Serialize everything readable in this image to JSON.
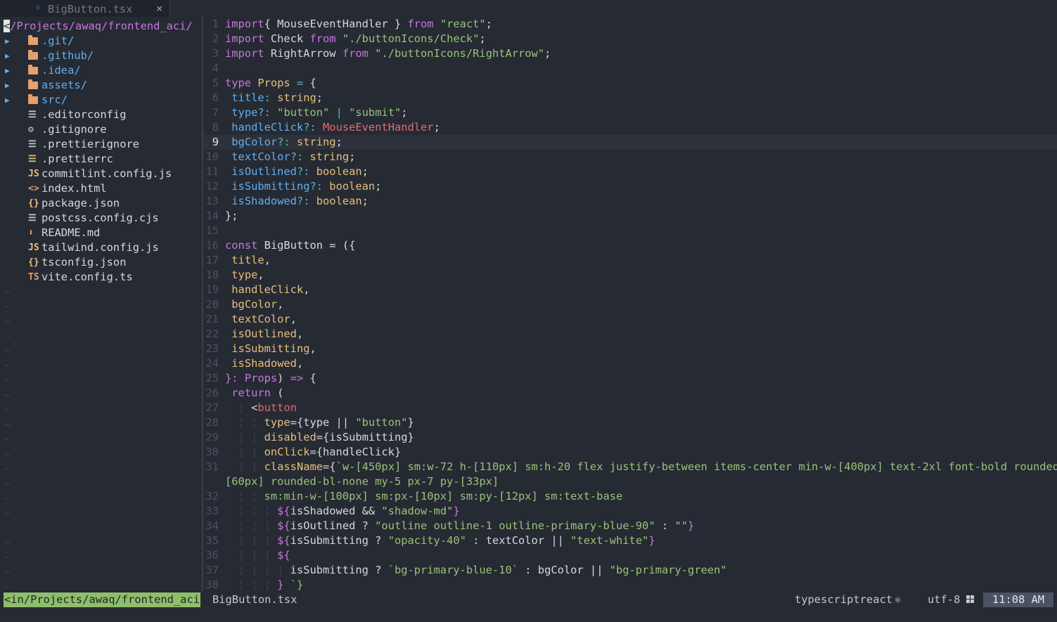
{
  "tab": {
    "icon": "react-icon",
    "title": "BigButton.tsx",
    "close": "×"
  },
  "tree": {
    "root": "/Projects/awaq/frontend_aci/",
    "root_cursor": "<",
    "items": [
      {
        "name": ".git/",
        "type": "dir",
        "icon": "folder-icon"
      },
      {
        "name": ".github/",
        "type": "dir",
        "icon": "folder-icon"
      },
      {
        "name": ".idea/",
        "type": "dir",
        "icon": "folder-icon"
      },
      {
        "name": "assets/",
        "type": "dir",
        "icon": "folder-icon"
      },
      {
        "name": "src/",
        "type": "dir",
        "icon": "folder-icon"
      },
      {
        "name": ".editorconfig",
        "type": "file",
        "icon": "lines-icon",
        "glyph": "☰",
        "color": "#c3c7cf"
      },
      {
        "name": ".gitignore",
        "type": "file",
        "icon": "gear-icon",
        "glyph": "⚙",
        "color": "#c3c7cf"
      },
      {
        "name": ".prettierignore",
        "type": "file",
        "icon": "lines-icon",
        "glyph": "☰",
        "color": "#c3c7cf"
      },
      {
        "name": ".prettierrc",
        "type": "file",
        "icon": "lines-icon",
        "glyph": "☰",
        "color": "#e5c07b"
      },
      {
        "name": "commitlint.config.js",
        "type": "file",
        "icon": "js-icon",
        "glyph": "JS",
        "color": "#e5c07b"
      },
      {
        "name": "index.html",
        "type": "file",
        "icon": "html-icon",
        "glyph": "<>",
        "color": "#e5a06b"
      },
      {
        "name": "package.json",
        "type": "file",
        "icon": "json-icon",
        "glyph": "{}",
        "color": "#e5c07b"
      },
      {
        "name": "postcss.config.cjs",
        "type": "file",
        "icon": "lines-icon",
        "glyph": "☰",
        "color": "#c3c7cf"
      },
      {
        "name": "README.md",
        "type": "file",
        "icon": "download-icon",
        "glyph": "⬇",
        "color": "#e5a06b"
      },
      {
        "name": "tailwind.config.js",
        "type": "file",
        "icon": "js-icon",
        "glyph": "JS",
        "color": "#e5c07b"
      },
      {
        "name": "tsconfig.json",
        "type": "file",
        "icon": "json-icon",
        "glyph": "{}",
        "color": "#e5c07b"
      },
      {
        "name": "vite.config.ts",
        "type": "file",
        "icon": "ts-icon",
        "glyph": "TS",
        "color": "#e5a06b"
      }
    ],
    "empty_marker": "~"
  },
  "editor": {
    "current_line": 9,
    "lines": [
      {
        "n": "1",
        "t": [
          [
            "k",
            "import"
          ],
          [
            "",
            "{ MouseEventHandler } "
          ],
          [
            "k",
            "from"
          ],
          [
            "s",
            " \"react\""
          ],
          [
            "",
            ";"
          ]
        ]
      },
      {
        "n": "2",
        "t": [
          [
            "k",
            "import"
          ],
          [
            "",
            ""
          ],
          [
            "",
            "Check "
          ],
          [
            "k",
            "from"
          ],
          [
            "s",
            " \"./buttonIcons/Check\""
          ],
          [
            "",
            ";"
          ]
        ]
      },
      {
        "n": "3",
        "t": [
          [
            "k",
            "import"
          ],
          [
            "",
            ""
          ],
          [
            "",
            "RightArrow "
          ],
          [
            "k",
            "from"
          ],
          [
            "s",
            " \"./buttonIcons/RightArrow\""
          ],
          [
            "",
            ";"
          ]
        ]
      },
      {
        "n": "4",
        "t": []
      },
      {
        "n": "5",
        "t": [
          [
            "k",
            "type"
          ],
          [
            "t",
            " Props"
          ],
          [
            "o",
            " ="
          ],
          [
            "",
            ""
          ],
          [
            "",
            "{"
          ]
        ]
      },
      {
        "n": "6",
        "t": [
          [
            "",
            ""
          ],
          [
            "p",
            "title"
          ],
          [
            "o",
            ":"
          ],
          [
            "t",
            " string"
          ],
          [
            "",
            ";"
          ]
        ]
      },
      {
        "n": "7",
        "t": [
          [
            "",
            ""
          ],
          [
            "p",
            "type"
          ],
          [
            "o",
            "?:"
          ],
          [
            "s",
            " \"button\""
          ],
          [
            "o",
            " |"
          ],
          [
            "s",
            " \"submit\""
          ],
          [
            "",
            ";"
          ]
        ]
      },
      {
        "n": "8",
        "t": [
          [
            "",
            ""
          ],
          [
            "p",
            "handleClick"
          ],
          [
            "o",
            "?:"
          ],
          [
            "r",
            " MouseEventHandler"
          ],
          [
            "",
            ";"
          ]
        ]
      },
      {
        "n": "9",
        "t": [
          [
            "",
            ""
          ],
          [
            "p",
            "bgColor"
          ],
          [
            "o",
            "?:"
          ],
          [
            "t",
            " string"
          ],
          [
            "",
            ";"
          ]
        ]
      },
      {
        "n": "10",
        "t": [
          [
            "",
            ""
          ],
          [
            "p",
            "textColor"
          ],
          [
            "o",
            "?:"
          ],
          [
            "t",
            " string"
          ],
          [
            "",
            ";"
          ]
        ]
      },
      {
        "n": "11",
        "t": [
          [
            "",
            ""
          ],
          [
            "p",
            "isOutlined"
          ],
          [
            "o",
            "?:"
          ],
          [
            "t",
            " boolean"
          ],
          [
            "",
            ";"
          ]
        ]
      },
      {
        "n": "12",
        "t": [
          [
            "",
            ""
          ],
          [
            "p",
            "isSubmitting"
          ],
          [
            "o",
            "?:"
          ],
          [
            "t",
            " boolean"
          ],
          [
            "",
            ";"
          ]
        ]
      },
      {
        "n": "13",
        "t": [
          [
            "",
            ""
          ],
          [
            "p",
            "isShadowed"
          ],
          [
            "o",
            "?:"
          ],
          [
            "t",
            " boolean"
          ],
          [
            "",
            ";"
          ]
        ]
      },
      {
        "n": "14",
        "t": [
          [
            "",
            "};"
          ]
        ]
      },
      {
        "n": "15",
        "t": []
      },
      {
        "n": "16",
        "t": [
          [
            "k",
            "const"
          ],
          [
            "",
            ""
          ],
          [
            "",
            "BigButton = ({"
          ]
        ]
      },
      {
        "n": "17",
        "t": [
          [
            "",
            ""
          ],
          [
            "pi",
            "title"
          ],
          [
            "",
            ","
          ]
        ]
      },
      {
        "n": "18",
        "t": [
          [
            "",
            ""
          ],
          [
            "pi",
            "type"
          ],
          [
            "",
            ","
          ]
        ]
      },
      {
        "n": "19",
        "t": [
          [
            "",
            ""
          ],
          [
            "pi",
            "handleClick"
          ],
          [
            "",
            ","
          ]
        ]
      },
      {
        "n": "20",
        "t": [
          [
            "",
            ""
          ],
          [
            "pi",
            "bgColor"
          ],
          [
            "",
            ","
          ]
        ]
      },
      {
        "n": "21",
        "t": [
          [
            "",
            ""
          ],
          [
            "pi",
            "textColor"
          ],
          [
            "",
            ","
          ]
        ]
      },
      {
        "n": "22",
        "t": [
          [
            "",
            ""
          ],
          [
            "pi",
            "isOutlined"
          ],
          [
            "",
            ","
          ]
        ]
      },
      {
        "n": "23",
        "t": [
          [
            "",
            ""
          ],
          [
            "pi",
            "isSubmitting"
          ],
          [
            "",
            ","
          ]
        ]
      },
      {
        "n": "24",
        "t": [
          [
            "",
            ""
          ],
          [
            "pi",
            "isShadowed"
          ],
          [
            "",
            ","
          ]
        ]
      },
      {
        "n": "25",
        "t": [
          [
            "k",
            "}:"
          ],
          [
            "k",
            " Props"
          ],
          [
            "",
            ")"
          ],
          [
            "k",
            " =>"
          ],
          [
            "",
            ""
          ],
          [
            "",
            "{"
          ]
        ]
      },
      {
        "n": "26",
        "t": [
          [
            "",
            ""
          ],
          [
            "k",
            "return"
          ],
          [
            "",
            ""
          ],
          [
            "",
            "("
          ]
        ]
      },
      {
        "n": "27",
        "t": [
          [
            "g",
            "  ¦ "
          ],
          [
            "",
            "<"
          ],
          [
            "r",
            "button"
          ]
        ]
      },
      {
        "n": "28",
        "t": [
          [
            "g",
            "  ¦ ¦ "
          ],
          [
            "t",
            "type"
          ],
          [
            "",
            "={type || "
          ],
          [
            "s",
            "\"button\""
          ],
          [
            "",
            "}"
          ]
        ]
      },
      {
        "n": "29",
        "t": [
          [
            "g",
            "  ¦ ¦ "
          ],
          [
            "t",
            "disabled"
          ],
          [
            "",
            "={isSubmitting}"
          ]
        ]
      },
      {
        "n": "30",
        "t": [
          [
            "g",
            "  ¦ ¦ "
          ],
          [
            "t",
            "onClick"
          ],
          [
            "",
            "={handleClick}"
          ]
        ]
      },
      {
        "n": "31",
        "t": [
          [
            "g",
            "  ¦ ¦ "
          ],
          [
            "t",
            "className"
          ],
          [
            "",
            "={"
          ],
          [
            "s",
            "`w-[450px] sm:w-72 h-[110px] sm:h-20 flex justify-between items-center min-w-[400px] text-2xl font-bold rounded-"
          ]
        ]
      },
      {
        "n": "",
        "t": [
          [
            "s",
            "[60px] rounded-bl-none my-5 px-7 py-[33px]"
          ]
        ]
      },
      {
        "n": "32",
        "t": [
          [
            "g",
            "  ¦ ¦ "
          ],
          [
            "s",
            "sm:min-w-[100px] sm:px-[10px] sm:py-[12px] sm:text-base"
          ]
        ]
      },
      {
        "n": "33",
        "t": [
          [
            "g",
            "  ¦ ¦ ¦ "
          ],
          [
            "k",
            "${"
          ],
          [
            "",
            "isShadowed && "
          ],
          [
            "s",
            "\"shadow-md\""
          ],
          [
            "k",
            "}"
          ]
        ]
      },
      {
        "n": "34",
        "t": [
          [
            "g",
            "  ¦ ¦ ¦ "
          ],
          [
            "k",
            "${"
          ],
          [
            "",
            "isOutlined ? "
          ],
          [
            "s",
            "\"outline outline-1 outline-primary-blue-90\""
          ],
          [
            "",
            " : "
          ],
          [
            "s",
            "\"\""
          ],
          [
            "k",
            "}"
          ]
        ]
      },
      {
        "n": "35",
        "t": [
          [
            "g",
            "  ¦ ¦ ¦ "
          ],
          [
            "k",
            "${"
          ],
          [
            "",
            "isSubmitting ? "
          ],
          [
            "s",
            "\"opacity-40\""
          ],
          [
            "",
            " : textColor || "
          ],
          [
            "s",
            "\"text-white\""
          ],
          [
            "k",
            "}"
          ]
        ]
      },
      {
        "n": "36",
        "t": [
          [
            "g",
            "  ¦ ¦ ¦ "
          ],
          [
            "k",
            "${"
          ]
        ]
      },
      {
        "n": "37",
        "t": [
          [
            "g",
            "  ¦ ¦ ¦ ¦ "
          ],
          [
            "",
            "isSubmitting ? "
          ],
          [
            "s",
            "`bg-primary-blue-10`"
          ],
          [
            "",
            " : bgColor || "
          ],
          [
            "s",
            "\"bg-primary-green\""
          ]
        ]
      },
      {
        "n": "38",
        "t": [
          [
            "g",
            "  ¦ ¦ ¦ "
          ],
          [
            "k",
            "}"
          ],
          [
            "s",
            " `}"
          ]
        ]
      }
    ]
  },
  "status": {
    "cwd": "<in/Projects/awaq/frontend_aci",
    "file": "BigButton.tsx",
    "filetype": "typescriptreact",
    "filetype_icon": "react-icon",
    "encoding": "utf-8",
    "os_icon": "windows-icon",
    "time": "11:08 AM"
  }
}
